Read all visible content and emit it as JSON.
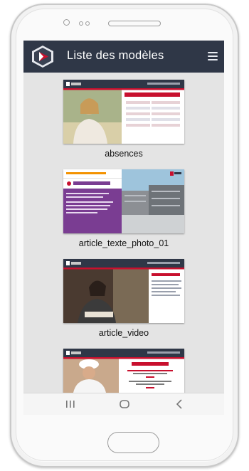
{
  "header": {
    "title": "Liste des modèles",
    "logo_icon": "app-logo-icon",
    "menu_icon": "hamburger-menu-icon"
  },
  "models": [
    {
      "name": "absences",
      "thumb": {
        "date": "mardi 16 juillet | 14:49:30",
        "heading": "ABSENCES PROFESSEURS",
        "brand": "ENT LOGO"
      }
    },
    {
      "name": "article_texte_photo_01",
      "thumb": {
        "date": "mardi 2 septembre | 08:20:16",
        "heading": "TITRE DE L'ARTICLE",
        "brand": "ENT LOGO"
      }
    },
    {
      "name": "article_video",
      "thumb": {
        "date": "mardi 16 juillet | 14:49:30",
        "heading": "TITRE DE LA VIDEO",
        "brand": "ENT LOGO"
      }
    },
    {
      "name": "",
      "thumb": {
        "date": "mardi 16 juillet | 14:47:02",
        "heading": "Menu du JOUR",
        "brand": "ENT LOGO"
      }
    }
  ],
  "navigation": {
    "recents_icon": "recent-apps-icon",
    "home_icon": "home-icon",
    "back_icon": "back-icon"
  },
  "colors": {
    "appbar": "#2f3747",
    "accent_red": "#c8102e",
    "accent_purple": "#7a3d92",
    "accent_orange": "#f39200"
  }
}
